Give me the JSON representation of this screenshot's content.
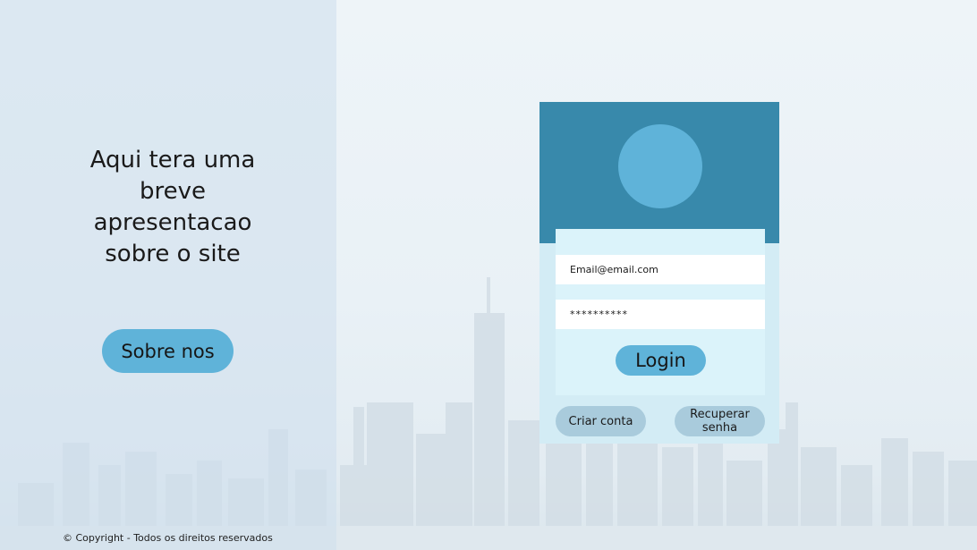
{
  "left_panel": {
    "intro_lines": [
      "Aqui tera uma",
      "breve",
      "apresentacao",
      "sobre o site"
    ],
    "about_button": "Sobre nos",
    "footer": "© Copyright - Todos os direitos reservados"
  },
  "login": {
    "email_value": "Email@email.com",
    "password_value": "**********",
    "login_button": "Login",
    "create_account_button": "Criar conta",
    "recover_password_button": "Recuperar senha"
  },
  "colors": {
    "accent": "#5fb3d9",
    "card_header": "#3889ab",
    "card_body": "#d3ecf5",
    "form_box": "#dbf3fa",
    "secondary_button": "#a9cbdc",
    "left_panel": "#cddeec"
  },
  "icons": {
    "avatar": "user-avatar-circle"
  }
}
